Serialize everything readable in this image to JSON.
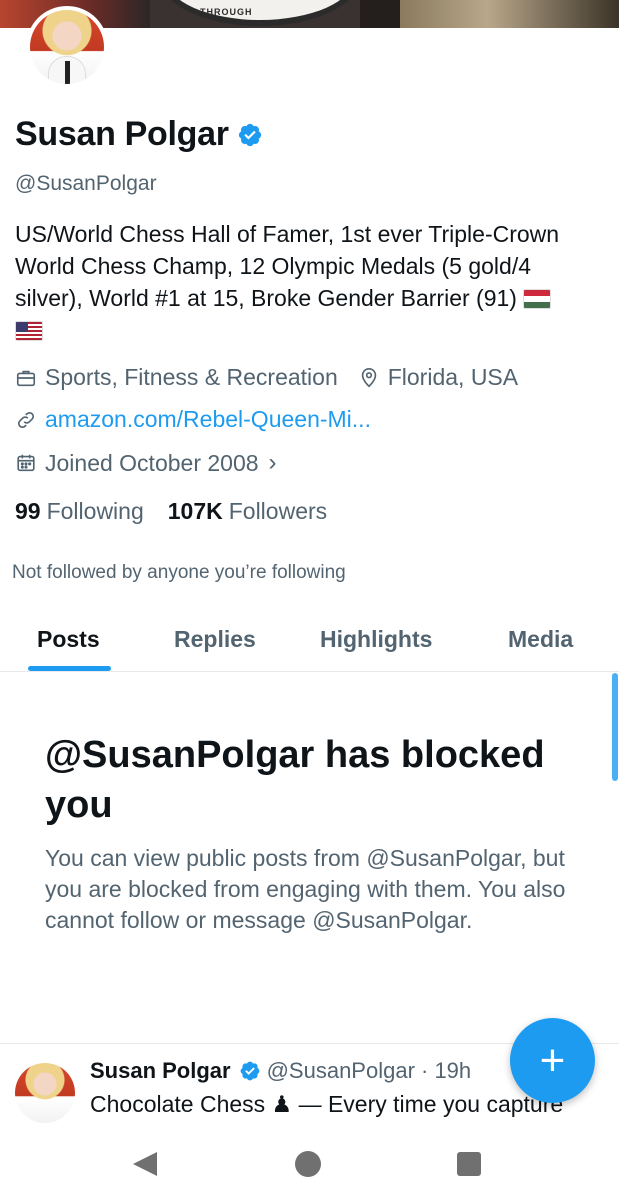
{
  "banner": {
    "seal_text": "THROUGH"
  },
  "profile": {
    "name": "Susan Polgar",
    "handle": "@SusanPolgar",
    "bio": "US/World Chess Hall of Famer, 1st ever Triple-Crown World Chess Champ, 12 Olympic Medals (5 gold/4 silver), World #1 at 15, Broke Gender Barrier (91)",
    "bio_flags": [
      "hungary-flag",
      "usa-flag"
    ],
    "category": "Sports, Fitness & Recreation",
    "location": "Florida, USA",
    "website": "amazon.com/Rebel-Queen-Mi...",
    "joined": "Joined October 2008",
    "following_count": "99",
    "following_label": "Following",
    "followers_count": "107K",
    "followers_label": "Followers",
    "not_followed_note": "Not followed by anyone you’re following"
  },
  "tabs": [
    {
      "label": "Posts",
      "active": true
    },
    {
      "label": "Replies",
      "active": false
    },
    {
      "label": "Highlights",
      "active": false
    },
    {
      "label": "Media",
      "active": false
    }
  ],
  "blocked": {
    "title": "@SusanPolgar has blocked you",
    "message": "You can view public posts from @SusanPolgar, but you are blocked from engaging with them. You also cannot follow or message @SusanPolgar."
  },
  "post": {
    "author": "Susan Polgar",
    "handle_time": "@SusanPolgar · 19h",
    "text_before": "Chocolate Chess",
    "pawn": "♟",
    "text_after": "— Every time you capture"
  },
  "fab": {
    "label": "+"
  },
  "colors": {
    "accent": "#1d9bf0",
    "text": "#0f1419",
    "muted": "#536471"
  },
  "icons": [
    "briefcase-icon",
    "location-pin-icon",
    "link-icon",
    "calendar-icon",
    "verified-badge-icon",
    "chevron-right-icon"
  ]
}
